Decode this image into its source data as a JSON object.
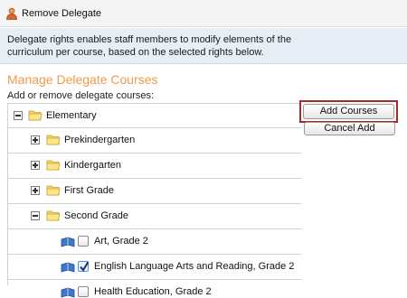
{
  "titlebar": {
    "title": "Remove Delegate",
    "icon": "user-icon"
  },
  "info": {
    "line1": "Delegate rights enables staff members to modify elements of the",
    "line2": "curriculum per course, based on the selected rights below."
  },
  "section": {
    "title": "Manage Delegate Courses",
    "subtitle": "Add or remove delegate courses:"
  },
  "tree": {
    "root": {
      "label": "Elementary",
      "expanded": true
    },
    "grades": [
      {
        "label": "Prekindergarten",
        "expanded": false
      },
      {
        "label": "Kindergarten",
        "expanded": false
      },
      {
        "label": "First Grade",
        "expanded": false
      },
      {
        "label": "Second Grade",
        "expanded": true
      }
    ],
    "courses": [
      {
        "label": "Art, Grade 2",
        "checked": false
      },
      {
        "label": "English Language Arts and Reading, Grade 2",
        "checked": true
      },
      {
        "label": "Health Education, Grade 2",
        "checked": false
      }
    ]
  },
  "buttons": {
    "add": "Add Courses",
    "cancel": "Cancel Add"
  },
  "colors": {
    "accent": "#f2994a",
    "highlight_border": "#a62b2b",
    "info_bg": "#e8eef6"
  }
}
